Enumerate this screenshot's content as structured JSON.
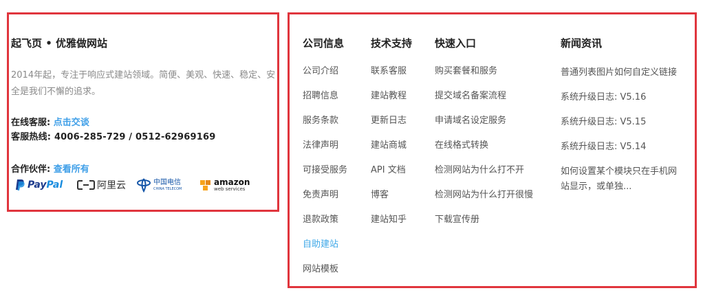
{
  "left_panel": {
    "brand_title": "起飞页 • 优雅做网站",
    "intro": "2014年起，专注于响应式建站领域。简便、美观、快速、稳定、安全是我们不懈的追求。",
    "service_label": "在线客服:",
    "service_link": "点击交谈",
    "hotline_label": "客服热线:",
    "hotline_value": "4006-285-729 / 0512-62969169",
    "partners_label": "合作伙伴:",
    "partners_link": "查看所有",
    "partner_logos": [
      {
        "name": "paypal",
        "text_a": "Pay",
        "text_b": "Pal"
      },
      {
        "name": "aliyun",
        "text": "阿里云"
      },
      {
        "name": "china-telecom",
        "text": "中国电信",
        "subtext": "CHINA TELECOM"
      },
      {
        "name": "amazon-web-services",
        "text": "amazon",
        "subtext": "web services"
      }
    ]
  },
  "columns": [
    {
      "heading": "公司信息",
      "items": [
        "公司介绍",
        "招聘信息",
        "服务条款",
        "法律声明",
        "可接受服务",
        "免责声明",
        "退款政策",
        "自助建站",
        "网站模板"
      ],
      "highlight_index": 7,
      "highlight_color": "#3fa8e8"
    },
    {
      "heading": "技术支持",
      "items": [
        "联系客服",
        "建站教程",
        "更新日志",
        "建站商城",
        "API 文档",
        "博客",
        "建站知乎"
      ]
    },
    {
      "heading": "快速入口",
      "items": [
        "购买套餐和服务",
        "提交域名备案流程",
        "申请域名设定服务",
        "在线格式转换",
        "检测网站为什么打不开",
        "检测网站为什么打开很慢",
        "下载宣传册"
      ]
    }
  ],
  "news": {
    "heading": "新闻资讯",
    "items": [
      "普通列表图片如何自定义链接",
      "系统升级日志: V5.16",
      "系统升级日志: V5.15",
      "系统升级日志: V5.14",
      "如何设置某个模块只在手机网站显示，或单独..."
    ]
  },
  "colors": {
    "highlight_border": "#e0353d",
    "link": "#3f9fe8"
  }
}
